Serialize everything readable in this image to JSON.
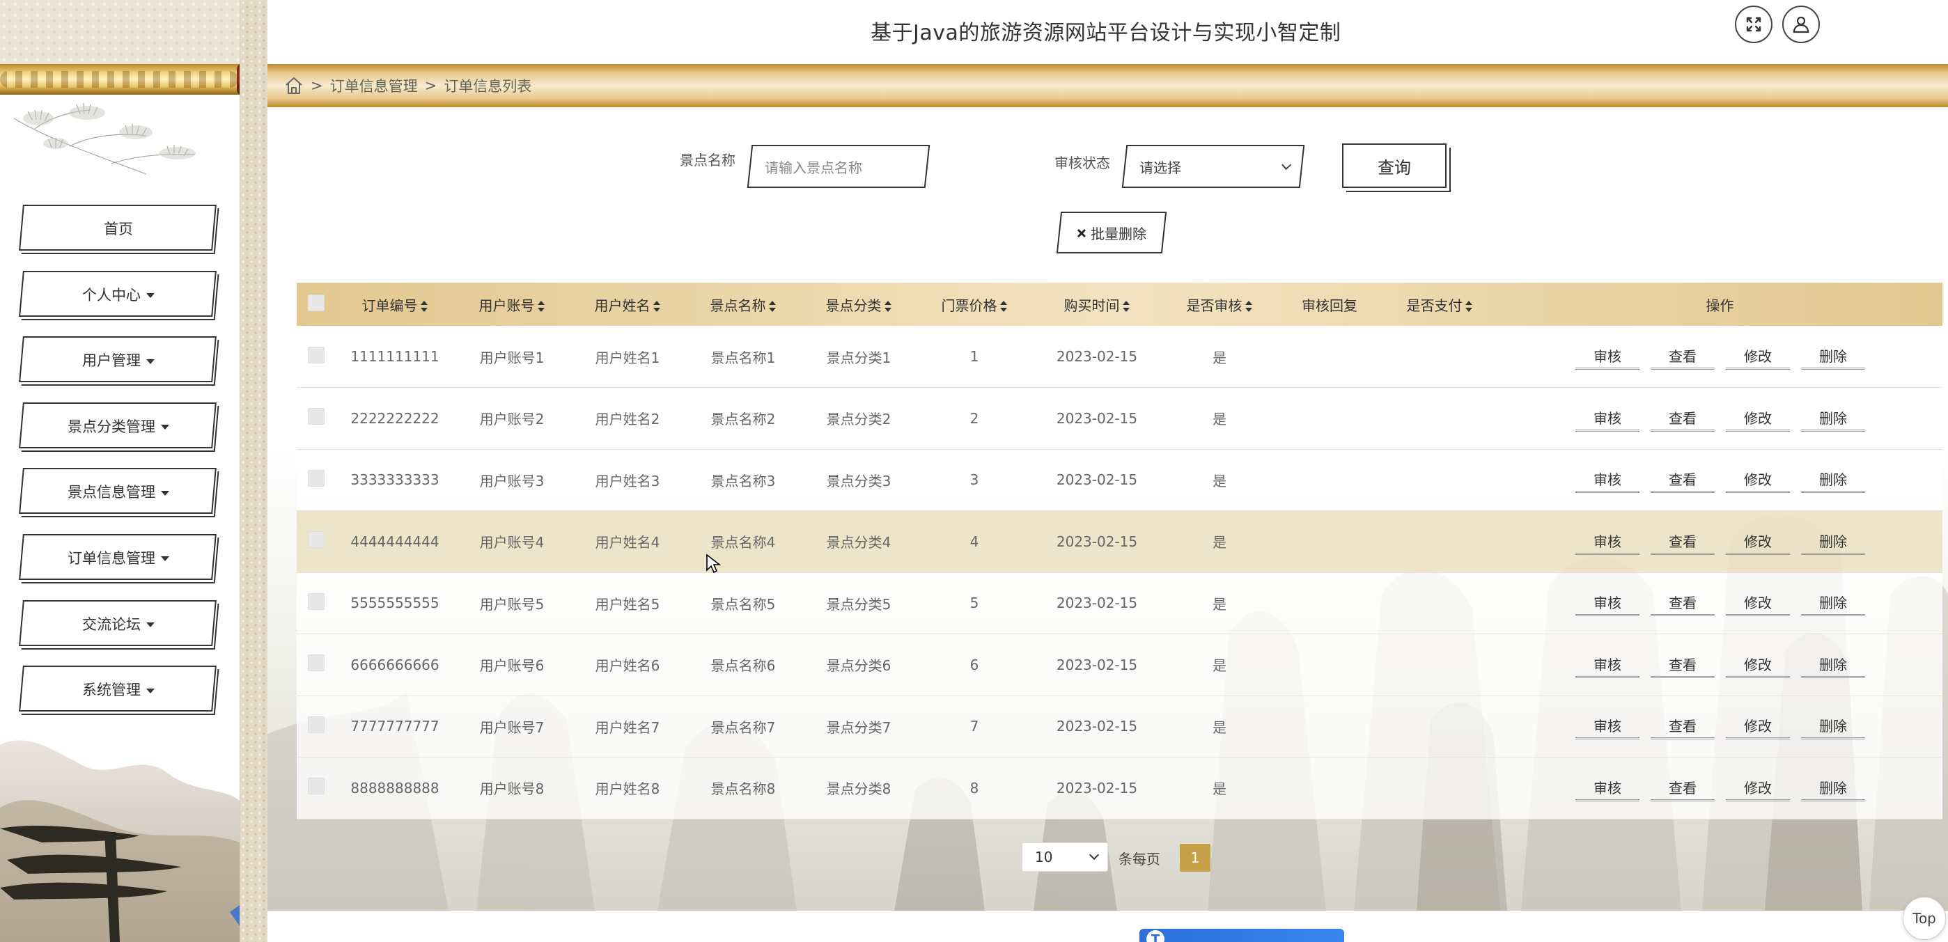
{
  "header": {
    "title": "基于Java的旅游资源网站平台设计与实现小智定制",
    "expand_icon": "fullscreen-icon",
    "user_icon": "user-icon"
  },
  "sidebar": {
    "items": [
      {
        "label": "首页",
        "has_caret": false
      },
      {
        "label": "个人中心",
        "has_caret": true
      },
      {
        "label": "用户管理",
        "has_caret": true
      },
      {
        "label": "景点分类管理",
        "has_caret": true
      },
      {
        "label": "景点信息管理",
        "has_caret": true
      },
      {
        "label": "订单信息管理",
        "has_caret": true
      },
      {
        "label": "交流论坛",
        "has_caret": true
      },
      {
        "label": "系统管理",
        "has_caret": true
      }
    ]
  },
  "breadcrumb": {
    "home_icon": "home-icon",
    "sep": ">",
    "items": [
      "订单信息管理",
      "订单信息列表"
    ]
  },
  "search": {
    "name_label": "景点名称",
    "name_placeholder": "请输入景点名称",
    "status_label": "审核状态",
    "status_value": "请选择",
    "query_label": "查询",
    "batch_delete_label": "批量删除"
  },
  "table": {
    "columns": [
      "订单编号",
      "用户账号",
      "用户姓名",
      "景点名称",
      "景点分类",
      "门票价格",
      "购买时间",
      "是否审核",
      "审核回复",
      "是否支付",
      "操作"
    ],
    "action_labels": [
      "审核",
      "查看",
      "修改",
      "删除"
    ],
    "rows": [
      {
        "order_no": "1111111111",
        "account": "用户账号1",
        "name": "用户姓名1",
        "spot": "景点名称1",
        "category": "景点分类1",
        "price": "1",
        "time": "2023-02-15",
        "reviewed": "是",
        "reply": "",
        "paid": ""
      },
      {
        "order_no": "2222222222",
        "account": "用户账号2",
        "name": "用户姓名2",
        "spot": "景点名称2",
        "category": "景点分类2",
        "price": "2",
        "time": "2023-02-15",
        "reviewed": "是",
        "reply": "",
        "paid": ""
      },
      {
        "order_no": "3333333333",
        "account": "用户账号3",
        "name": "用户姓名3",
        "spot": "景点名称3",
        "category": "景点分类3",
        "price": "3",
        "time": "2023-02-15",
        "reviewed": "是",
        "reply": "",
        "paid": ""
      },
      {
        "order_no": "4444444444",
        "account": "用户账号4",
        "name": "用户姓名4",
        "spot": "景点名称4",
        "category": "景点分类4",
        "price": "4",
        "time": "2023-02-15",
        "reviewed": "是",
        "reply": "",
        "paid": ""
      },
      {
        "order_no": "5555555555",
        "account": "用户账号5",
        "name": "用户姓名5",
        "spot": "景点名称5",
        "category": "景点分类5",
        "price": "5",
        "time": "2023-02-15",
        "reviewed": "是",
        "reply": "",
        "paid": ""
      },
      {
        "order_no": "6666666666",
        "account": "用户账号6",
        "name": "用户姓名6",
        "spot": "景点名称6",
        "category": "景点分类6",
        "price": "6",
        "time": "2023-02-15",
        "reviewed": "是",
        "reply": "",
        "paid": ""
      },
      {
        "order_no": "7777777777",
        "account": "用户账号7",
        "name": "用户姓名7",
        "spot": "景点名称7",
        "category": "景点分类7",
        "price": "7",
        "time": "2023-02-15",
        "reviewed": "是",
        "reply": "",
        "paid": ""
      },
      {
        "order_no": "8888888888",
        "account": "用户账号8",
        "name": "用户姓名8",
        "spot": "景点名称8",
        "category": "景点分类8",
        "price": "8",
        "time": "2023-02-15",
        "reviewed": "是",
        "reply": "",
        "paid": ""
      }
    ]
  },
  "pagination": {
    "page_size": "10",
    "per_page_label": "条每页",
    "current_page": "1"
  },
  "top_button_label": "Top",
  "translate_widget": {
    "letter": "T"
  },
  "colors": {
    "accent_gold": "#c6a14a",
    "header_band": "#e3c78f",
    "hover_row": "#ede2c6"
  }
}
